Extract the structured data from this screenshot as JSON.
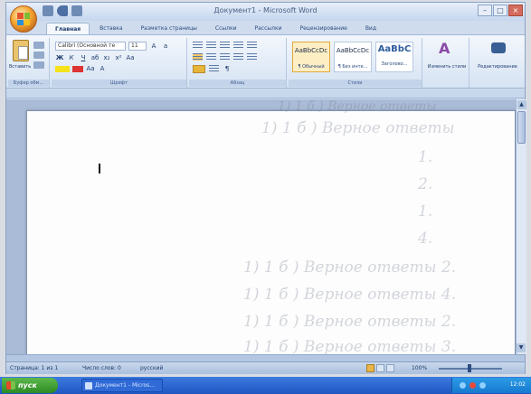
{
  "window": {
    "title": "Документ1 - Microsoft Word"
  },
  "tabs": [
    {
      "label": "Главная"
    },
    {
      "label": "Вставка"
    },
    {
      "label": "Разметка страницы"
    },
    {
      "label": "Ссылки"
    },
    {
      "label": "Рассылки"
    },
    {
      "label": "Рецензирование"
    },
    {
      "label": "Вид"
    }
  ],
  "ribbon": {
    "clipboard": {
      "paste_label": "Вставить",
      "group_label": "Буфер обм..."
    },
    "font": {
      "font_name": "Calibri (Основной те",
      "font_size": "11",
      "group_label": "Шрифт"
    },
    "paragraph": {
      "group_label": "Абзац"
    },
    "styles": {
      "items": [
        {
          "sample": "AaBbCcDc",
          "name": "¶ Обычный"
        },
        {
          "sample": "AaBbCcDc",
          "name": "¶ Без инте..."
        },
        {
          "sample": "AaBbC",
          "name": "Заголово..."
        }
      ],
      "group_label": "Стили"
    },
    "change_styles": {
      "label": "Изменить стили"
    },
    "editing": {
      "label": "Редактирование"
    }
  },
  "bleed_text": [
    "1) 1 б ) Верное ответы",
    "1) 1 б ) Верное ответы",
    "1.",
    "2.",
    "1.",
    "4.",
    "1) 1 б ) Верное ответы  2.",
    "1) 1 б ) Верное ответы  4.",
    "1) 1 б ) Верное ответы  2.",
    "1) 1 б ) Верное ответы  3."
  ],
  "statusbar": {
    "page": "Страница: 1 из 1",
    "words": "Число слов: 0",
    "language": "русский",
    "zoom": "100%"
  },
  "taskbar": {
    "start_label": "пуск",
    "task_label": "Документ1 - Micros...",
    "clock": "12:02"
  }
}
